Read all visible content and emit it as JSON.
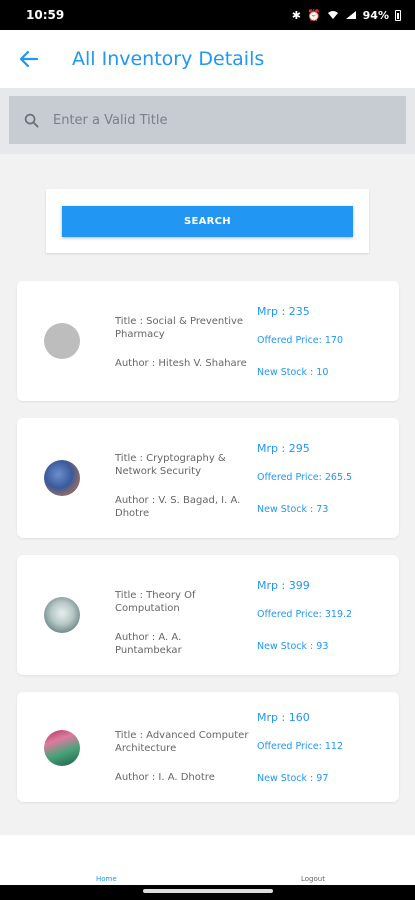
{
  "status_bar": {
    "time": "10:59",
    "battery": "94%"
  },
  "app_bar": {
    "title": "All Inventory Details"
  },
  "search": {
    "placeholder": "Enter a Valid Title",
    "button_label": "SEARCH"
  },
  "books": [
    {
      "title": "Title : Social & Preventive Pharmacy",
      "author": "Author : Hitesh V. Shahare",
      "mrp": "Mrp : 235",
      "offered_price": "Offered Price: 170",
      "new_stock": "New Stock : 10"
    },
    {
      "title": "Title : Cryptography & Network Security",
      "author": "Author : V. S. Bagad, I. A. Dhotre",
      "mrp": "Mrp : 295",
      "offered_price": "Offered Price: 265.5",
      "new_stock": "New Stock : 73"
    },
    {
      "title": "Title : Theory Of Computation",
      "author": "Author : A. A. Puntambekar",
      "mrp": "Mrp : 399",
      "offered_price": "Offered Price: 319.2",
      "new_stock": "New Stock : 93"
    },
    {
      "title": "Title : Advanced Computer Architecture",
      "author": "Author : I. A. Dhotre",
      "mrp": "Mrp : 160",
      "offered_price": "Offered Price: 112",
      "new_stock": "New Stock : 97"
    }
  ],
  "bottom_nav": {
    "home": "Home",
    "logout": "Logout"
  },
  "colors": {
    "accent": "#2196f3",
    "search_bg": "#c7ccd3",
    "page_bg": "#f2f2f2"
  }
}
